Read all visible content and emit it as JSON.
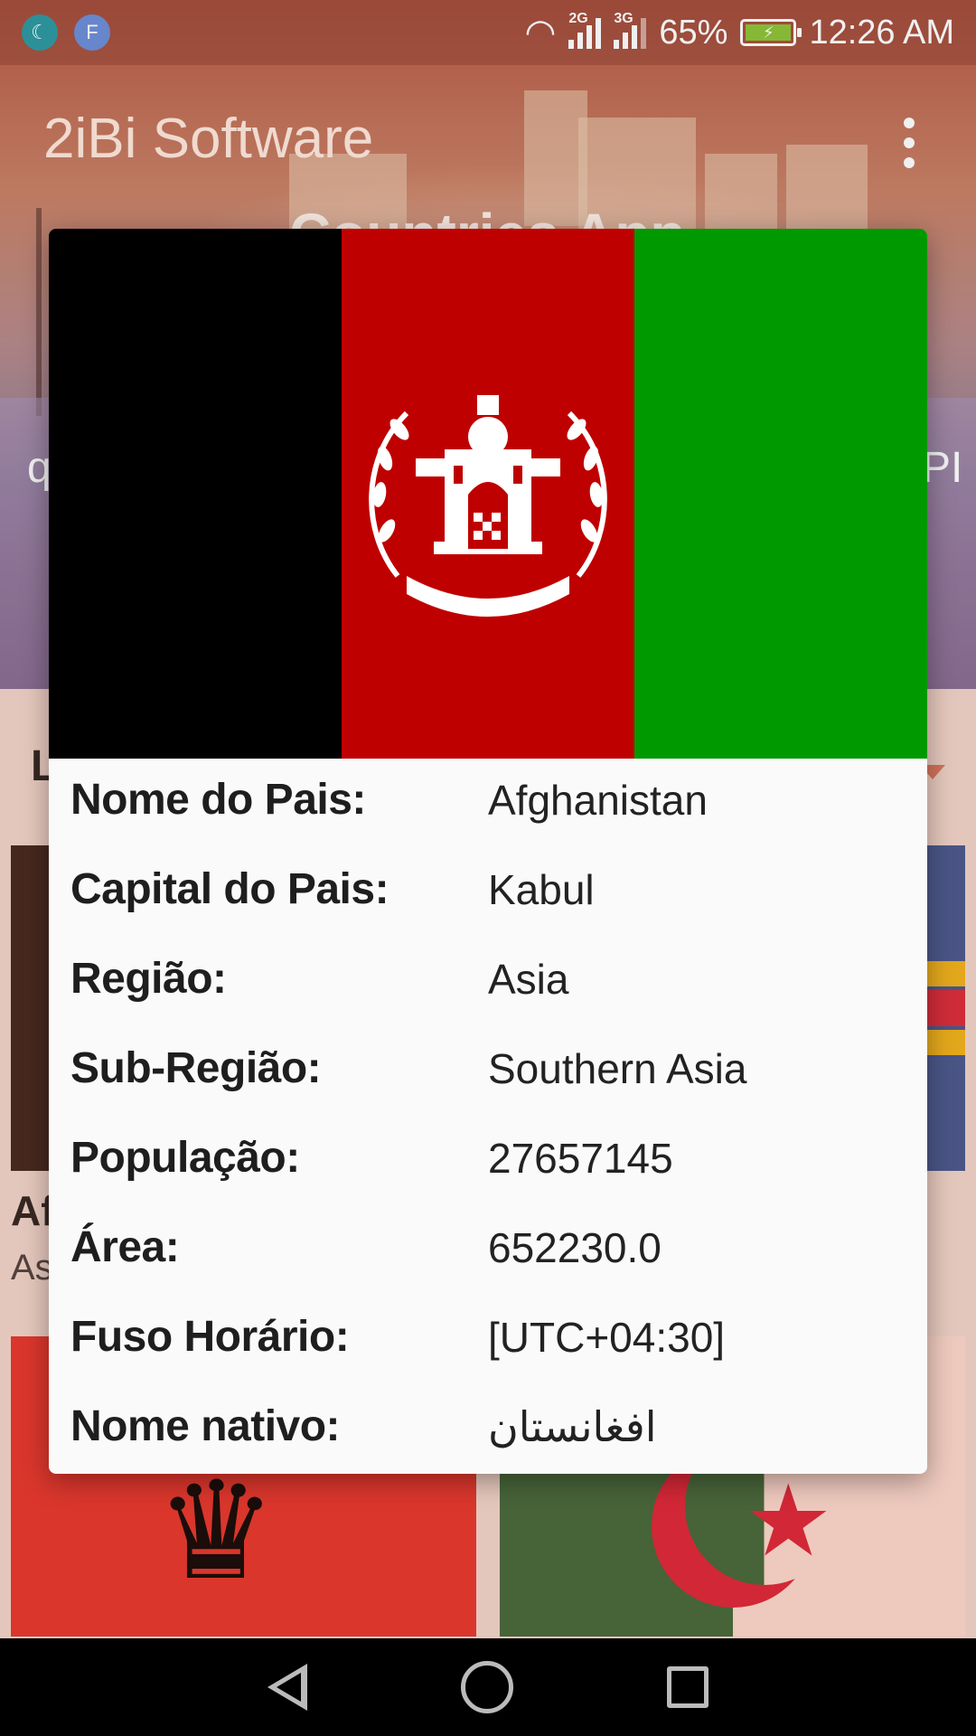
{
  "status_bar": {
    "left_icons": [
      "moon-icon",
      "f-icon"
    ],
    "f_letter": "F",
    "network_1": "2G",
    "network_2": "3G",
    "battery": "65%",
    "time": "12:26 AM"
  },
  "app_bar": {
    "title": "2iBi Software",
    "menu_icon": "more-vert-icon"
  },
  "background": {
    "header_peek": "Countries App",
    "side_left_peek": "q",
    "side_right_peek": "PI",
    "list_letter": "L",
    "card_peek_name": "Af",
    "card_peek_region": "As"
  },
  "dialog": {
    "flag_colors": {
      "black": "#000000",
      "red": "#be0000",
      "green": "#009900"
    },
    "rows": [
      {
        "label": "Nome do Pais:",
        "value": "Afghanistan"
      },
      {
        "label": "Capital do Pais:",
        "value": "Kabul"
      },
      {
        "label": "Região:",
        "value": "Asia"
      },
      {
        "label": "Sub-Região:",
        "value": "Southern Asia"
      },
      {
        "label": "População:",
        "value": "27657145"
      },
      {
        "label": "Área:",
        "value": "652230.0"
      },
      {
        "label": "Fuso Horário:",
        "value": "[UTC+04:30]"
      },
      {
        "label": "Nome nativo:",
        "value": "افغانستان"
      }
    ]
  },
  "nav_bar": {
    "icons": [
      "back-icon",
      "home-icon",
      "recents-icon"
    ]
  }
}
